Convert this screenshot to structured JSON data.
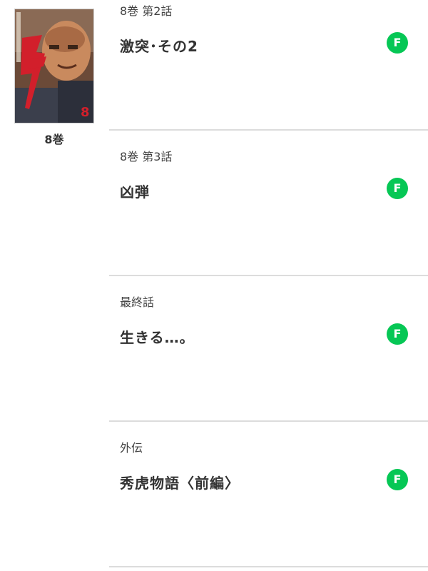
{
  "volume": {
    "label": "8巻",
    "cover_alt": "8巻 cover"
  },
  "badge_color": "#06c755",
  "episodes": [
    {
      "number": "8巻 第2話",
      "title": "激突･その2",
      "badge": "F"
    },
    {
      "number": "8巻 第3話",
      "title": "凶弾",
      "badge": "F"
    },
    {
      "number": "最終話",
      "title": "生きる…。",
      "badge": "F"
    },
    {
      "number": "外伝",
      "title": "秀虎物語〈前編〉",
      "badge": "F"
    }
  ]
}
